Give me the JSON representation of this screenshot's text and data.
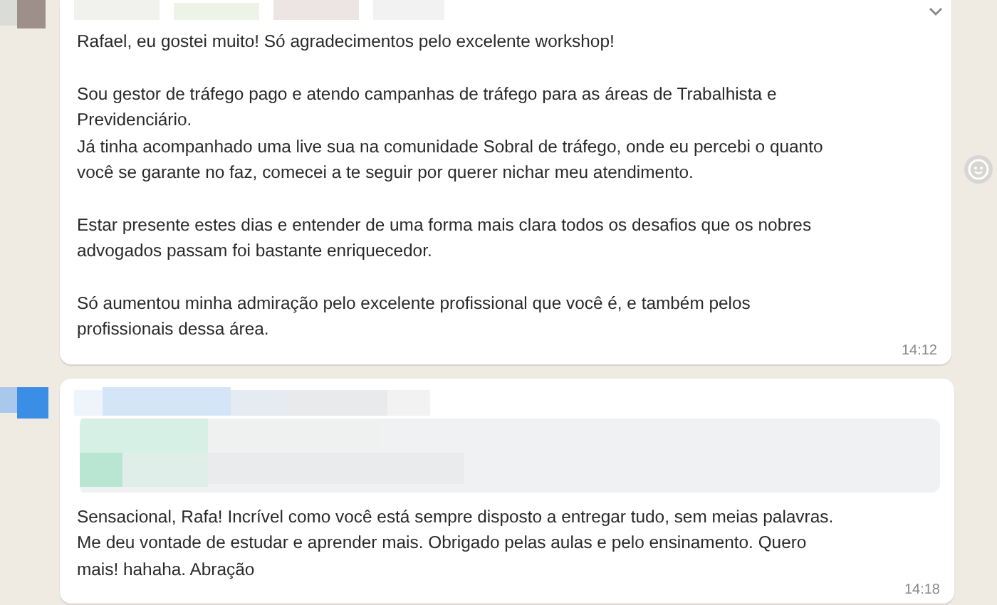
{
  "messages": [
    {
      "paragraphs": [
        "Rafael, eu gostei muito! Só agradecimentos pelo excelente workshop!",
        "Sou gestor de tráfego pago e atendo campanhas de tráfego para as áreas de Trabalhista e\nPrevidenciário.\nJá tinha acompanhado uma live sua na comunidade Sobral de tráfego, onde eu percebi o quanto\nvocê se garante no faz, comecei a te seguir por querer nichar meu atendimento.",
        "Estar presente estes dias e entender de uma forma mais clara todos os desafios que os nobres\nadvogados passam foi bastante enriquecedor.",
        "Só aumentou minha admiração pelo excelente profissional que você é, e também pelos\nprofissionais dessa área."
      ],
      "time": "14:12",
      "quoted": false
    },
    {
      "paragraphs": [
        "Sensacional, Rafa! Incrível como você está sempre disposto a entregar tudo, sem meias palavras.\nMe deu vontade de estudar e aprender mais. Obrigado pelas aulas e pelo ensinamento. Quero\nmais! hahaha. Abração"
      ],
      "time": "14:18",
      "quoted": true
    }
  ]
}
